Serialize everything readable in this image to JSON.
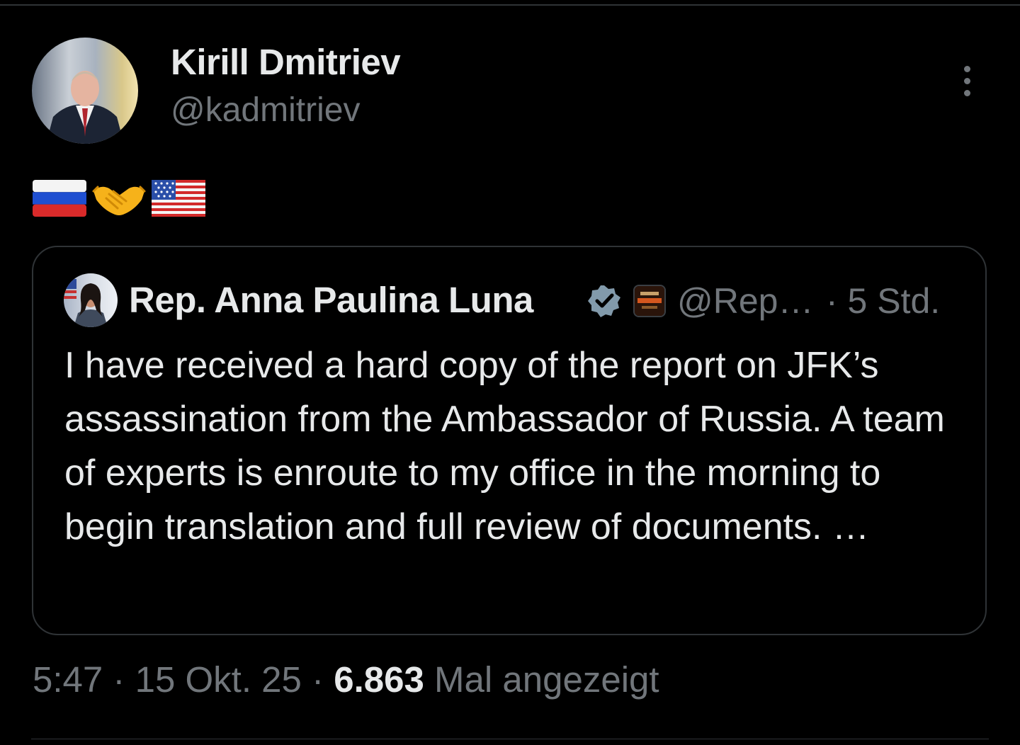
{
  "author": {
    "name": "Kirill Dmitriev",
    "handle": "@kadmitriev",
    "avatar_icon": "profile-photo"
  },
  "tweet": {
    "emojis": [
      "flag-russia",
      "handshake",
      "flag-united-states"
    ]
  },
  "quoted_tweet": {
    "name": "Rep. Anna Paulina Luna",
    "verified_icon": "verified-badge",
    "affiliate_icon": "affiliate-badge",
    "handle": "@Rep…",
    "time": "· 5 Std.",
    "text": "I have received a hard copy of the report on JFK’s assassination from the Ambassador of Russia. A team of experts is enroute to my office in the morning to begin translation and full review of documents.  …"
  },
  "meta": {
    "time": "5:47",
    "sep1": " · ",
    "date": "15 Okt. 25",
    "sep2": " · ",
    "views_count": "6.863",
    "views_label": " Mal angezeigt"
  },
  "colors": {
    "background": "#000000",
    "text_primary": "#e7e9ea",
    "text_secondary": "#71767b",
    "border": "#2f3336",
    "verified": "#829aab"
  }
}
